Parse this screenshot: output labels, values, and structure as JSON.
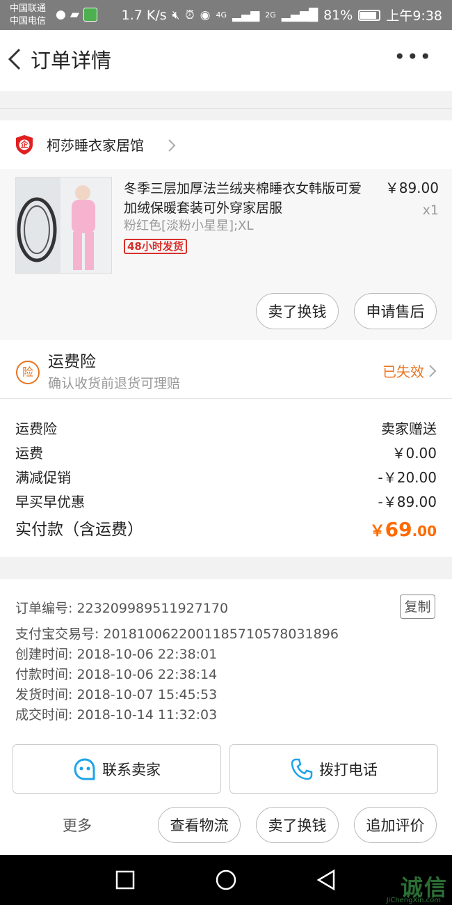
{
  "status_bar": {
    "carrier_1": "中国联通",
    "carrier_2": "中国电信",
    "speed": "1.7 K/s",
    "net_1": "4G",
    "net_2": "2G",
    "battery": "81%",
    "time": "上午9:38"
  },
  "header": {
    "title": "订单详情",
    "more": "•••"
  },
  "shop": {
    "badge": "企",
    "name": "柯莎睡衣家居馆"
  },
  "product": {
    "name": "冬季三层加厚法兰绒夹棉睡衣女韩版可爱加绒保暖套装可外穿家居服",
    "spec": "粉红色[淡粉小星星];XL",
    "tag": "48小时发货",
    "price": "￥89.00",
    "qty": "x1",
    "buttons": [
      "卖了换钱",
      "申请售后"
    ]
  },
  "insurance": {
    "icon": "险",
    "title": "运费险",
    "subtitle": "确认收货前退货可理赔",
    "status": "已失效"
  },
  "fees": [
    {
      "label": "运费险",
      "value": "卖家赠送"
    },
    {
      "label": "运费",
      "value": "￥0.00"
    },
    {
      "label": "满减促销",
      "value": "-￥20.00"
    },
    {
      "label": "早买早优惠",
      "value": "-￥89.00"
    }
  ],
  "total": {
    "label": "实付款（含运费）",
    "currency": "￥",
    "amount_int": "69",
    "amount_dec": ".00"
  },
  "order_info": {
    "copy_label": "复制",
    "rows": [
      "订单编号: 223209989511927170",
      "支付宝交易号: 2018100622001185710578031896",
      "创建时间: 2018-10-06 22:38:01",
      "付款时间: 2018-10-06 22:38:14",
      "发货时间: 2018-10-07 15:45:53",
      "成交时间: 2018-10-14 11:32:03"
    ]
  },
  "contact": {
    "seller": "联系卖家",
    "phone": "拨打电话"
  },
  "bottom_bar": {
    "more": "更多",
    "buttons": [
      "查看物流",
      "卖了换钱",
      "追加评价"
    ]
  },
  "watermark": {
    "text": "诚信",
    "sub": "JiChengXin.com"
  },
  "colors": {
    "accent": "#ff6a00",
    "insurance": "#e8731f",
    "contact_icon": "#1fa3e8"
  }
}
